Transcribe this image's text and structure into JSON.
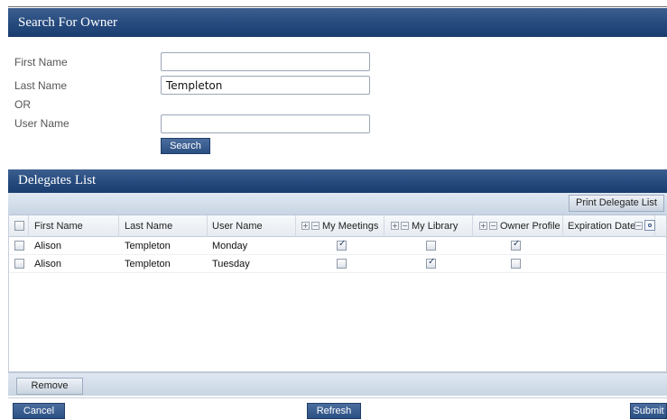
{
  "search": {
    "header_title": "Search For Owner",
    "first_name_label": "First Name",
    "first_name_value": "",
    "last_name_label": "Last Name",
    "last_name_value": "Templeton",
    "or_label": "OR",
    "user_name_label": "User Name",
    "user_name_value": "",
    "search_button": "Search"
  },
  "delegates": {
    "header_title": "Delegates List",
    "print_button": "Print Delegate List",
    "columns": {
      "first_name": "First Name",
      "last_name": "Last Name",
      "user_name": "User Name",
      "my_meetings": "My Meetings",
      "my_library": "My Library",
      "owner_profile": "Owner Profile",
      "expiration_date": "Expiration Date"
    },
    "rows": [
      {
        "first_name": "Alison",
        "last_name": "Templeton",
        "user_name": "Monday",
        "my_meetings": true,
        "my_library": false,
        "owner_profile": true,
        "selected": false
      },
      {
        "first_name": "Alison",
        "last_name": "Templeton",
        "user_name": "Tuesday",
        "my_meetings": false,
        "my_library": true,
        "owner_profile": false,
        "selected": false
      }
    ],
    "remove_button": "Remove"
  },
  "footer": {
    "cancel_button": "Cancel",
    "refresh_button": "Refresh",
    "submit_button": "Submit"
  },
  "icons": {
    "plus": "plus-icon",
    "minus": "minus-icon",
    "calendar": "calendar-icon",
    "checkmark": "checkmark-icon"
  },
  "colors": {
    "header_blue": "#254a7d",
    "button_blue": "#2c4f82",
    "strip": "#c9d5e4"
  }
}
